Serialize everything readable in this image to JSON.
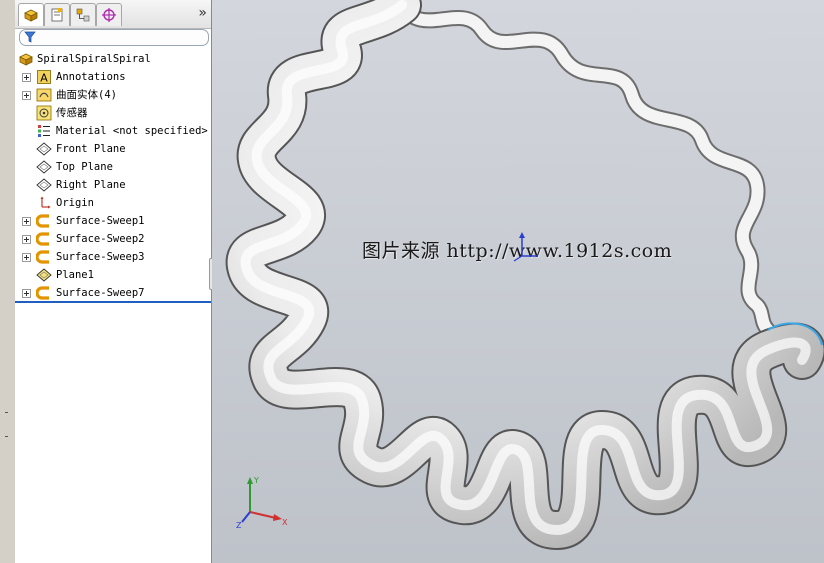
{
  "feature_tree": {
    "root": {
      "label": "SpiralSpiralSpiral",
      "icon": "part-icon"
    },
    "items": [
      {
        "label": "Annotations",
        "icon": "annotations-icon",
        "expandable": true
      },
      {
        "label": "曲面实体(4)",
        "icon": "surface-bodies-icon",
        "expandable": true
      },
      {
        "label": "传感器",
        "icon": "sensors-icon",
        "expandable": false
      },
      {
        "label": "Material <not specified>",
        "icon": "material-icon",
        "expandable": false
      },
      {
        "label": "Front Plane",
        "icon": "plane-icon",
        "expandable": false
      },
      {
        "label": "Top Plane",
        "icon": "plane-icon",
        "expandable": false
      },
      {
        "label": "Right Plane",
        "icon": "plane-icon",
        "expandable": false
      },
      {
        "label": "Origin",
        "icon": "origin-icon",
        "expandable": false
      },
      {
        "label": "Surface-Sweep1",
        "icon": "sweep-icon",
        "expandable": true
      },
      {
        "label": "Surface-Sweep2",
        "icon": "sweep-icon",
        "expandable": true
      },
      {
        "label": "Surface-Sweep3",
        "icon": "sweep-icon",
        "expandable": true
      },
      {
        "label": "Plane1",
        "icon": "plane-icon",
        "expandable": false
      },
      {
        "label": "Surface-Sweep7",
        "icon": "sweep-icon",
        "expandable": true
      }
    ]
  },
  "tabs": [
    {
      "icon": "feature-manager-icon",
      "active": true
    },
    {
      "icon": "property-manager-icon",
      "active": false
    },
    {
      "icon": "configuration-manager-icon",
      "active": false
    },
    {
      "icon": "dimxpert-icon",
      "active": false
    }
  ],
  "tab_overflow_label": "»",
  "viewport": {
    "watermark": "图片来源 http://www.1912s.com",
    "triad": {
      "x": "X",
      "y": "Y",
      "z": "Z"
    }
  },
  "colors": {
    "accent": "#1f5fbf",
    "sweep_icon": "#f0a000",
    "model_surface": "#f2f2f2",
    "viewport_bg": "#c9cdd4"
  }
}
